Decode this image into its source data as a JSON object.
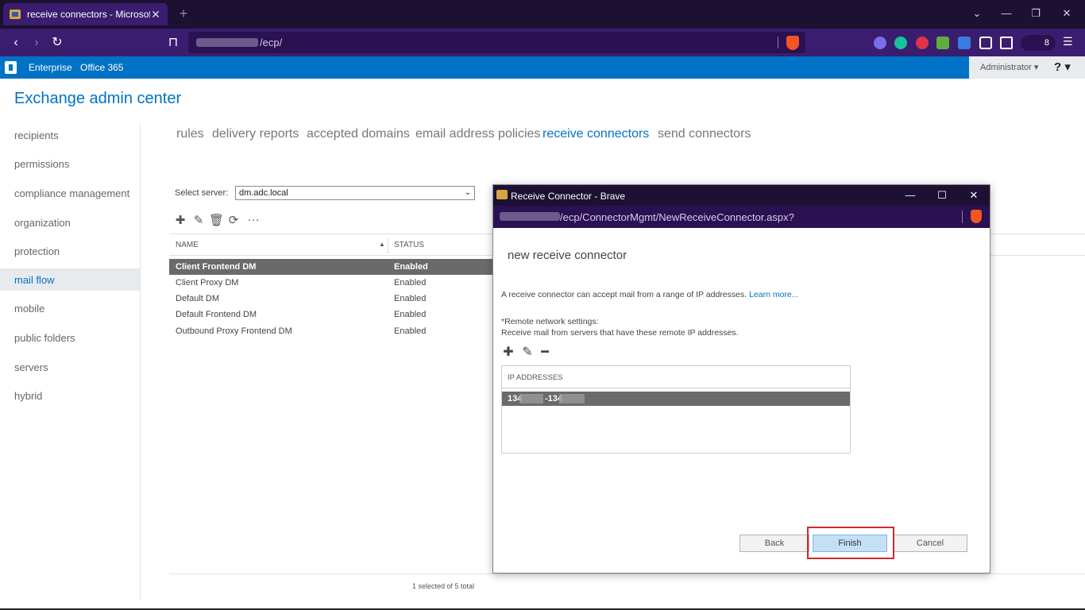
{
  "browser": {
    "tab_title": "receive connectors - Microsoft",
    "tab_close": "✕",
    "new_tab": "+",
    "url_path": "/ecp/",
    "extensions_count": "8",
    "menu": "☰",
    "win_min": "⌄",
    "win_restore": "—",
    "win_max": "❐",
    "win_close": "✕"
  },
  "suite": {
    "enterprise": "Enterprise",
    "office365": "Office 365",
    "admin": "Administrator ▾",
    "help": "? ▾"
  },
  "eac": {
    "title": "Exchange admin center",
    "nav": [
      "recipients",
      "permissions",
      "compliance management",
      "organization",
      "protection",
      "mail flow",
      "mobile",
      "public folders",
      "servers",
      "hybrid"
    ],
    "selected_nav": "mail flow",
    "tabs": [
      "rules",
      "delivery reports",
      "accepted domains",
      "email address policies",
      "receive connectors",
      "send connectors"
    ],
    "selected_tab": "receive connectors",
    "select_server_label": "Select server:",
    "select_server_value": "dm.adc.local",
    "columns": {
      "name": "NAME",
      "status": "STATUS"
    },
    "rows": [
      {
        "name": "Client Frontend DM",
        "status": "Enabled"
      },
      {
        "name": "Client Proxy DM",
        "status": "Enabled"
      },
      {
        "name": "Default DM",
        "status": "Enabled"
      },
      {
        "name": "Default Frontend DM",
        "status": "Enabled"
      },
      {
        "name": "Outbound Proxy Frontend DM",
        "status": "Enabled"
      }
    ],
    "footer": "1 selected of 5 total"
  },
  "popup": {
    "window_title": "Receive Connector - Brave",
    "url_path": "/ecp/ConnectorMgmt/NewReceiveConnector.aspx?",
    "heading": "new receive connector",
    "description": "A receive connector can accept mail from a range of IP addresses. ",
    "learn_more": "Learn more...",
    "remote_title": "*Remote network settings:",
    "remote_desc": "Receive mail from servers that have these remote IP addresses.",
    "ip_header": "IP ADDRESSES",
    "ip_prefix_1": "134",
    "ip_prefix_2": "-134",
    "buttons": {
      "back": "Back",
      "finish": "Finish",
      "cancel": "Cancel"
    }
  },
  "colors": {
    "accent": "#0072c6",
    "highlight": "#d0282e"
  }
}
